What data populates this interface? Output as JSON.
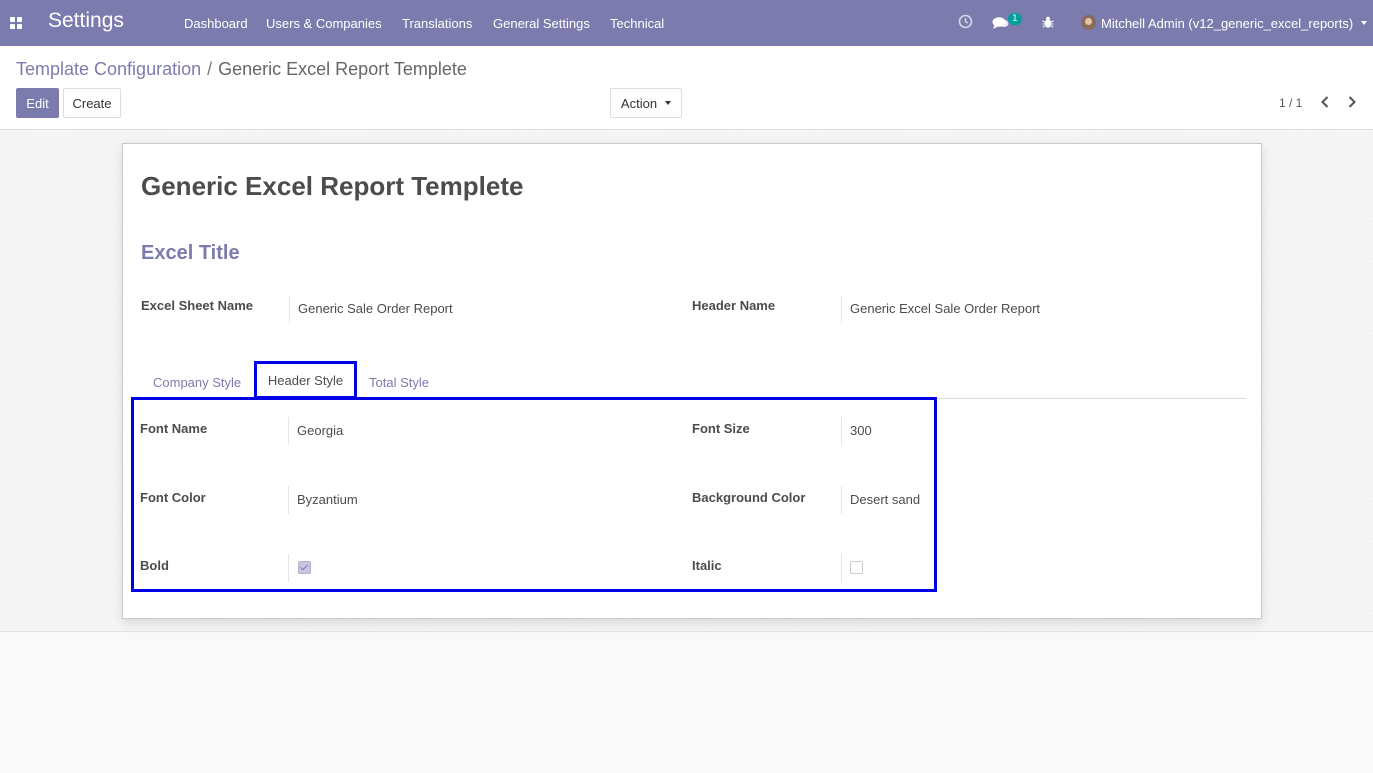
{
  "navbar": {
    "app_name": "Settings",
    "menu": [
      {
        "label": "Dashboard"
      },
      {
        "label": "Users & Companies"
      },
      {
        "label": "Translations"
      },
      {
        "label": "General Settings"
      },
      {
        "label": "Technical"
      }
    ],
    "systray": {
      "messages_badge": "1",
      "user_name": "Mitchell Admin (v12_generic_excel_reports)"
    }
  },
  "breadcrumb": {
    "parent": "Template Configuration",
    "separator": "/",
    "current": "Generic Excel Report Templete"
  },
  "toolbar": {
    "edit_label": "Edit",
    "create_label": "Create",
    "action_label": "Action",
    "pager": "1 / 1"
  },
  "record": {
    "title": "Generic Excel Report Templete",
    "section_title": "Excel Title",
    "fields": {
      "sheet_name": {
        "label": "Excel Sheet Name",
        "value": "Generic Sale Order Report"
      },
      "header_name": {
        "label": "Header Name",
        "value": "Generic Excel Sale Order Report"
      }
    }
  },
  "tabs": [
    {
      "label": "Company Style",
      "active": false
    },
    {
      "label": "Header Style",
      "active": true
    },
    {
      "label": "Total Style",
      "active": false
    }
  ],
  "header_style": {
    "font_name": {
      "label": "Font Name",
      "value": "Georgia"
    },
    "font_size": {
      "label": "Font Size",
      "value": "300"
    },
    "font_color": {
      "label": "Font Color",
      "value": "Byzantium"
    },
    "background_color": {
      "label": "Background Color",
      "value": "Desert sand"
    },
    "bold": {
      "label": "Bold",
      "checked": true
    },
    "italic": {
      "label": "Italic",
      "checked": false
    }
  },
  "colors": {
    "brand": "#7c7bad",
    "highlight": "#0000e6",
    "badge": "#00a09d"
  }
}
